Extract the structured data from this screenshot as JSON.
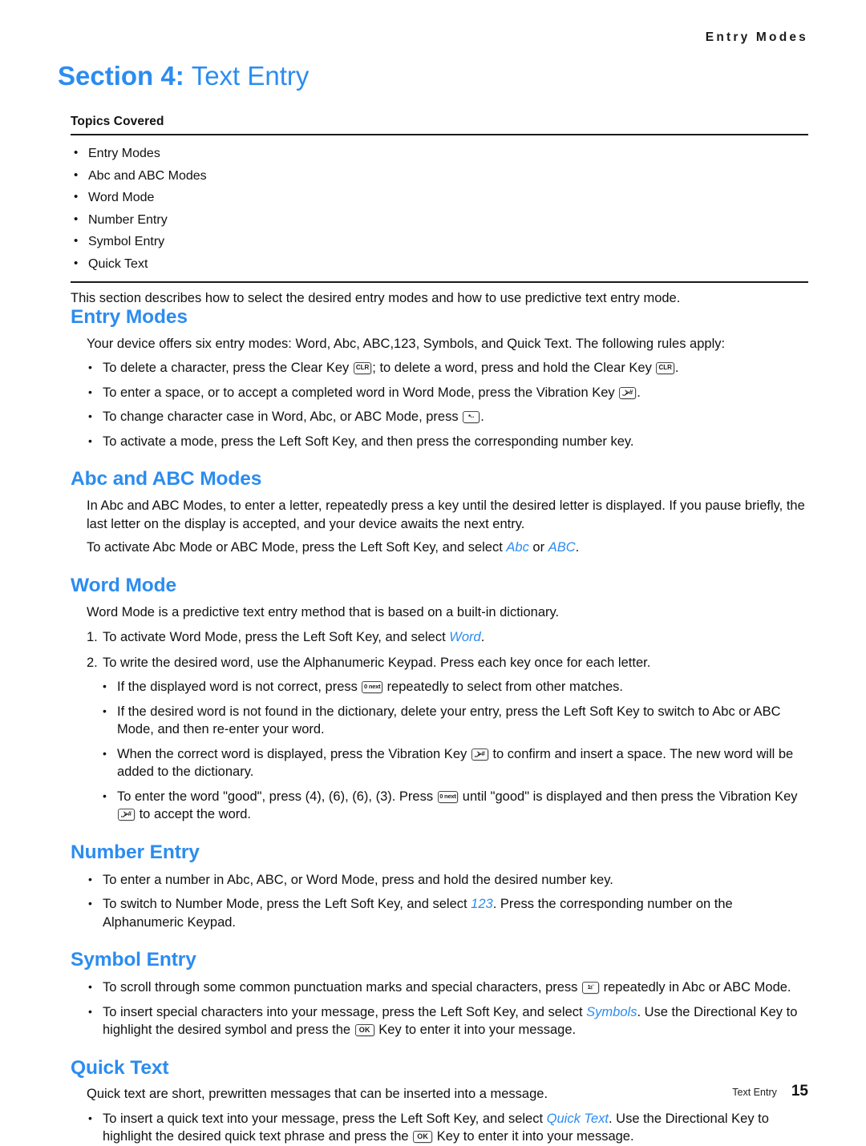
{
  "running_header": "Entry Modes",
  "section_title": {
    "number_label": "Section 4:",
    "name_label": "Text Entry"
  },
  "topics": {
    "label": "Topics Covered",
    "items": [
      "Entry Modes",
      "Abc and ABC Modes",
      "Word Mode",
      "Number Entry",
      "Symbol Entry",
      "Quick Text"
    ]
  },
  "intro_paragraph": "This section describes how to select the desired entry modes and how to use predictive text entry mode.",
  "key_icons": {
    "clear_key": "CLR",
    "vibration_key": "⎵⮚#",
    "star_key": "*··",
    "zero_next_key": "0 next",
    "one_punct_key": "1⦂¨",
    "ok_key": "OK"
  },
  "sections": {
    "entry_modes": {
      "heading": "Entry Modes",
      "paragraph": "Your device offers six entry modes: Word, Abc, ABC,123, Symbols, and Quick Text. The following rules apply:",
      "bullets": {
        "b1_part1": "To delete a character, press the Clear Key",
        "b1_part2": "; to delete a word, press and hold the Clear Key",
        "b1_part3": ".",
        "b2_part1": "To enter a space, or to accept a completed word in Word Mode, press the Vibration Key",
        "b2_part2": ".",
        "b3_part1": "To change character case in Word, Abc, or ABC Mode, press",
        "b3_part2": ".",
        "b4": "To activate a mode, press the Left Soft Key, and then press the corresponding number key."
      }
    },
    "abc_modes": {
      "heading": "Abc and ABC Modes",
      "paragraph1": "In Abc and ABC Modes, to enter a letter, repeatedly press a key until the desired letter is displayed. If you pause briefly, the last letter on the display is accepted, and your device awaits the next entry.",
      "p2_part1": "To activate Abc Mode or ABC Mode, press the Left Soft Key, and select ",
      "p2_em1": "Abc",
      "p2_part2": " or ",
      "p2_em2": "ABC",
      "p2_part3": "."
    },
    "word_mode": {
      "heading": "Word Mode",
      "paragraph": "Word Mode is a predictive text entry method that is based on a built-in dictionary.",
      "step1_num": "1.",
      "step1_part1": "To activate Word Mode, press the Left Soft Key, and select ",
      "step1_em": "Word",
      "step1_part2": ".",
      "step2_num": "2.",
      "step2": "To write the desired word, use the Alphanumeric Keypad. Press each key once for each letter.",
      "sub1_part1": "If the displayed word is not correct, press",
      "sub1_part2": "repeatedly to select from other matches.",
      "sub2": "If the desired word is not found in the dictionary, delete your entry, press the Left Soft Key to switch to Abc or ABC Mode, and then re-enter your word.",
      "sub3_part1": "When the correct word is displayed, press the Vibration Key",
      "sub3_part2": "to confirm and insert a space. The new word will be added to the dictionary.",
      "sub4_part1": "To enter the word \"good\", press (4), (6), (6), (3). Press",
      "sub4_part2": "until \"good\" is displayed and then press the Vibration Key",
      "sub4_part3": "to accept the word."
    },
    "number_entry": {
      "heading": "Number Entry",
      "b1": "To enter a number in Abc, ABC, or Word Mode, press and hold the desired number key.",
      "b2_part1": "To switch to Number Mode, press the Left Soft Key, and select ",
      "b2_em": "123",
      "b2_part2": ". Press the corresponding number on the Alphanumeric Keypad."
    },
    "symbol_entry": {
      "heading": "Symbol Entry",
      "b1_part1": "To scroll through some common punctuation marks and special characters, press",
      "b1_part2": "repeatedly in Abc or ABC Mode.",
      "b2_part1": "To insert special characters into your message, press the Left Soft Key, and select ",
      "b2_em": "Symbols",
      "b2_part2": ". Use the Directional Key to highlight the desired symbol and press the",
      "b2_part3": "Key to enter it into your message."
    },
    "quick_text": {
      "heading": "Quick Text",
      "paragraph": "Quick text are short, prewritten messages that can be inserted into a message.",
      "b1_part1": "To insert a quick text into your message, press the Left Soft Key, and select ",
      "b1_em": "Quick Text",
      "b1_part2": ". Use the Directional Key to highlight the desired quick text phrase and press the",
      "b1_part3": "Key to enter it into your message."
    }
  },
  "footer": {
    "label": "Text Entry",
    "page_number": "15"
  },
  "colors": {
    "heading_blue": "#2b8cf0",
    "body_text": "#111111"
  }
}
